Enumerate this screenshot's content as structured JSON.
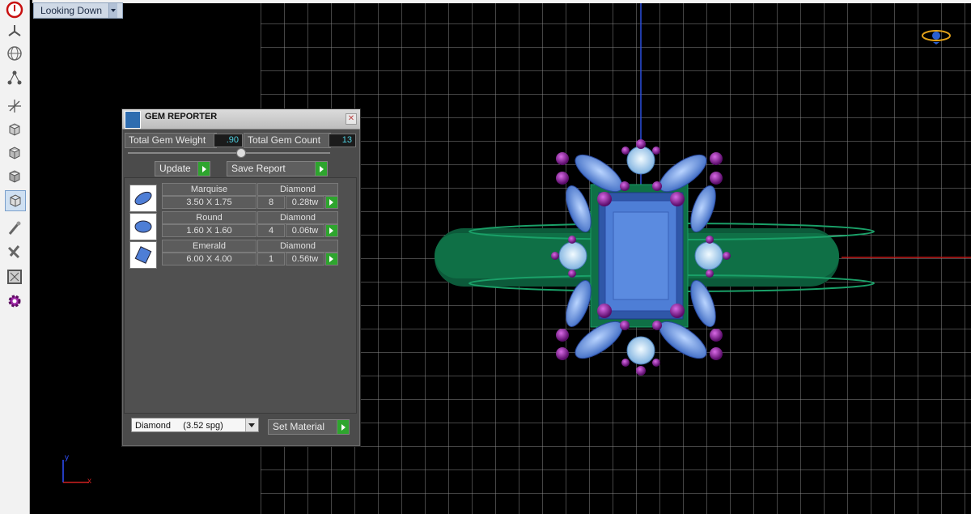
{
  "viewport": {
    "view_label": "Looking Down"
  },
  "toolbar": {
    "items": [
      {
        "name": "power-icon"
      },
      {
        "name": "fan-icon"
      },
      {
        "name": "globe-icon"
      },
      {
        "name": "nodes-icon"
      },
      {
        "name": "axes-icon"
      },
      {
        "name": "cube-front-icon"
      },
      {
        "name": "cube-side-icon"
      },
      {
        "name": "cube-top-icon"
      },
      {
        "name": "cube-iso-icon"
      },
      {
        "name": "wand-icon"
      },
      {
        "name": "tools-icon"
      },
      {
        "name": "frame-icon"
      },
      {
        "name": "gear-icon"
      }
    ]
  },
  "panel": {
    "title": "GEM REPORTER",
    "total_weight_label": "Total Gem Weight",
    "total_weight_value": ".90",
    "total_count_label": "Total Gem Count",
    "total_count_value": "13",
    "update_label": "Update",
    "save_report_label": "Save Report",
    "gems": [
      {
        "shape": "Marquise",
        "size": "3.50 X 1.75",
        "material": "Diamond",
        "count": "8",
        "weight": "0.28tw",
        "icon": "marquise-gem-icon"
      },
      {
        "shape": "Round",
        "size": "1.60 X 1.60",
        "material": "Diamond",
        "count": "4",
        "weight": "0.06tw",
        "icon": "round-gem-icon"
      },
      {
        "shape": "Emerald",
        "size": "6.00 X 4.00",
        "material": "Diamond",
        "count": "1",
        "weight": "0.56tw",
        "icon": "emerald-gem-icon"
      }
    ],
    "material_select": "Diamond     (3.52 spg)",
    "set_material_label": "Set Material"
  },
  "axis": {
    "x_label": "x",
    "y_label": "y"
  },
  "colors": {
    "ring_band": "#0d6b45",
    "gem_blue": "#4e7ed6",
    "prong": "#8a1fa0",
    "grid": "#8a8a8a",
    "axis_y": "#2a4fe0",
    "axis_x": "#c01818"
  }
}
